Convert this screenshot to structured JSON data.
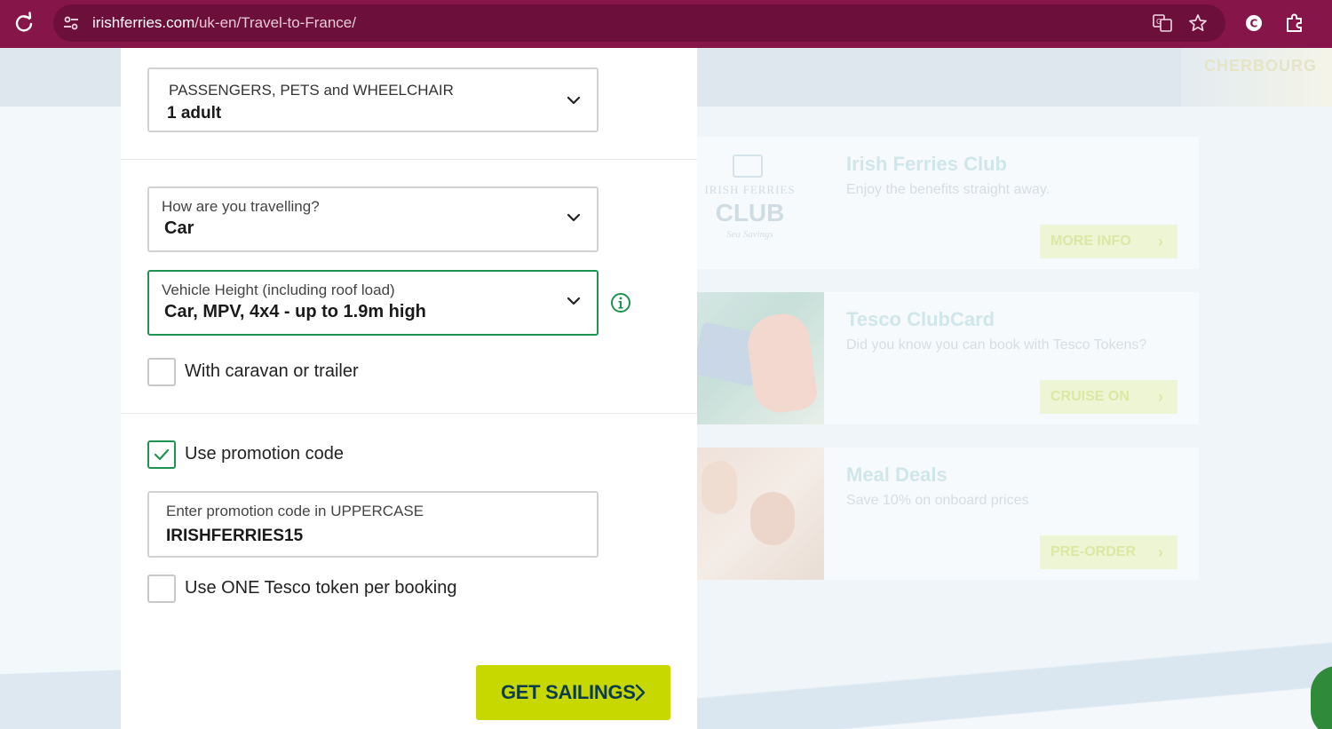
{
  "browser": {
    "url_domain": "irishferries.com",
    "url_path": "/uk-en/Travel-to-France/"
  },
  "background": {
    "hero_text": "CHERBOURG",
    "cards": [
      {
        "title": "Irish Ferries Club",
        "subtitle": "Enjoy the benefits straight away.",
        "button": "MORE INFO",
        "logo_line1": "IRISH FERRIES",
        "logo_line2": "CLUB",
        "logo_line3": "Sea Savings"
      },
      {
        "title": "Tesco ClubCard",
        "subtitle": "Did you know you can book with Tesco Tokens?",
        "button": "CRUISE ON"
      },
      {
        "title": "Meal Deals",
        "subtitle": "Save 10% on onboard prices",
        "button": "PRE-ORDER"
      }
    ]
  },
  "form": {
    "passengers": {
      "label": "PASSENGERS, PETS and WHEELCHAIR",
      "value": "1 adult"
    },
    "travel_mode": {
      "label": "How are you travelling?",
      "value": "Car"
    },
    "vehicle_height": {
      "label": "Vehicle Height (including roof load)",
      "value": "Car, MPV, 4x4 - up to 1.9m high"
    },
    "caravan": {
      "label": "With caravan or trailer",
      "checked": false
    },
    "promo_toggle": {
      "label": "Use promotion code",
      "checked": true
    },
    "promo_code": {
      "label": "Enter promotion code in UPPERCASE",
      "value": "IRISHFERRIES15"
    },
    "tesco_token": {
      "label": "Use ONE Tesco token per booking",
      "checked": false
    },
    "submit_label": "GET SAILINGS"
  },
  "colors": {
    "browser_bar": "#86164a",
    "accent_green": "#1e9450",
    "cta": "#c7d800",
    "cta_text": "#0c3c4c"
  }
}
